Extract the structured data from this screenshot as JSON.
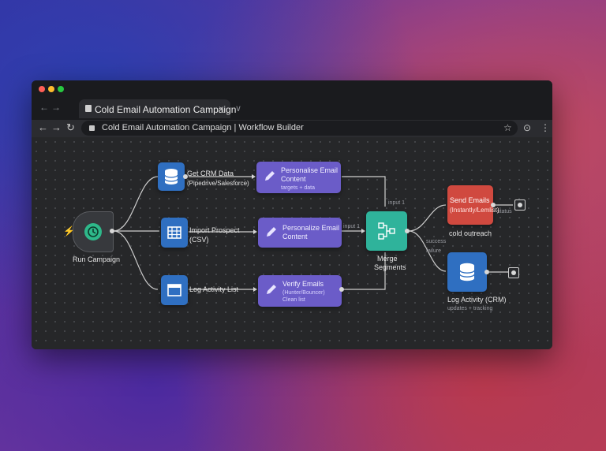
{
  "browser": {
    "tab": {
      "title": "Cold Email Automation Campaign",
      "close": "×"
    },
    "new_tab": "∨",
    "nav": {
      "back": "←",
      "forward": "→",
      "reload": "↻"
    },
    "tab_nav": {
      "back": "←",
      "forward": "→"
    },
    "url": "Cold Email Automation Campaign | Workflow Builder",
    "toolbar_icons": {
      "star": "☆",
      "extension": "⊙",
      "menu": "⋮"
    }
  },
  "workflow": {
    "trigger": {
      "label": "Run Campaign",
      "icon": "clock-icon",
      "bolt": "⚡"
    },
    "nodes": {
      "get_crm": {
        "title": "Get CRM Data",
        "subtitle": "(Pipedrive/Salesforce)",
        "icon": "database-icon"
      },
      "import": {
        "title": "Import Prospect",
        "subtitle": "(CSV)",
        "icon": "table-icon"
      },
      "log_list": {
        "title": "Log Activity List",
        "icon": "window-icon"
      },
      "personalise_top": {
        "title": "Personalise Email",
        "title2": "Content",
        "subtitle": "targets + data",
        "icon": "pencil-icon"
      },
      "personalize_mid": {
        "title": "Personalize Email",
        "title2": "Content",
        "icon": "pencil-icon"
      },
      "verify": {
        "title": "Verify Emails",
        "subtitle": "(Hunter/Bouncer)",
        "subtitle2": "Clean list",
        "icon": "pencil-icon"
      },
      "merge": {
        "title": "Merge",
        "title2": "Segments",
        "icon": "merge-icon"
      },
      "send": {
        "title": "Send Emails",
        "subtitle": "(Instantly/Lemlist)",
        "caption": "cold outreach",
        "icon": "send-icon"
      },
      "log_crm": {
        "title": "Log Activity (CRM)",
        "caption": "updates + tracking",
        "icon": "database-icon"
      }
    },
    "edge_labels": {
      "input_top": "input 1",
      "input_mid": "input 1",
      "success": "success",
      "failure": "failure",
      "send_status": "status"
    }
  },
  "colors": {
    "database": "#2f6fc1",
    "card": "#6b5cc8",
    "merge": "#2fb39b",
    "send": "#d0493f",
    "trigger": "#2eb88a"
  }
}
